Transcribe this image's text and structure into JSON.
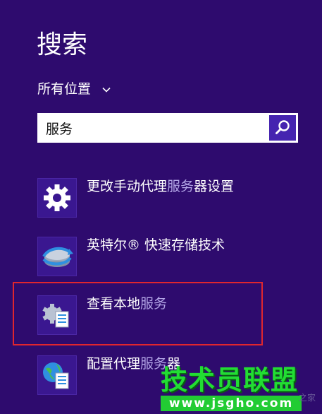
{
  "panel": {
    "title": "搜索",
    "scope_label": "所有位置"
  },
  "search": {
    "value": "服务",
    "button_icon": "search-icon"
  },
  "results": [
    {
      "pre": "更改手动代理",
      "hl": "服务",
      "post": "器设置",
      "icon": "gear-icon"
    },
    {
      "pre": "英特尔® 快速存储技术",
      "hl": "",
      "post": "",
      "icon": "storage-icon"
    },
    {
      "pre": "查看本地",
      "hl": "服务",
      "post": "",
      "icon": "services-icon"
    },
    {
      "pre": "配置代理",
      "hl": "服务",
      "post": "器",
      "icon": "globe-settings-icon"
    }
  ],
  "watermark": {
    "main": "技术员联盟",
    "url": "www.jsgho.com",
    "side": "之家"
  },
  "colors": {
    "background": "#2e0b6e",
    "accent": "#4524b0",
    "highlight_box": "#e0262e",
    "match_text": "#b3a5e6"
  }
}
